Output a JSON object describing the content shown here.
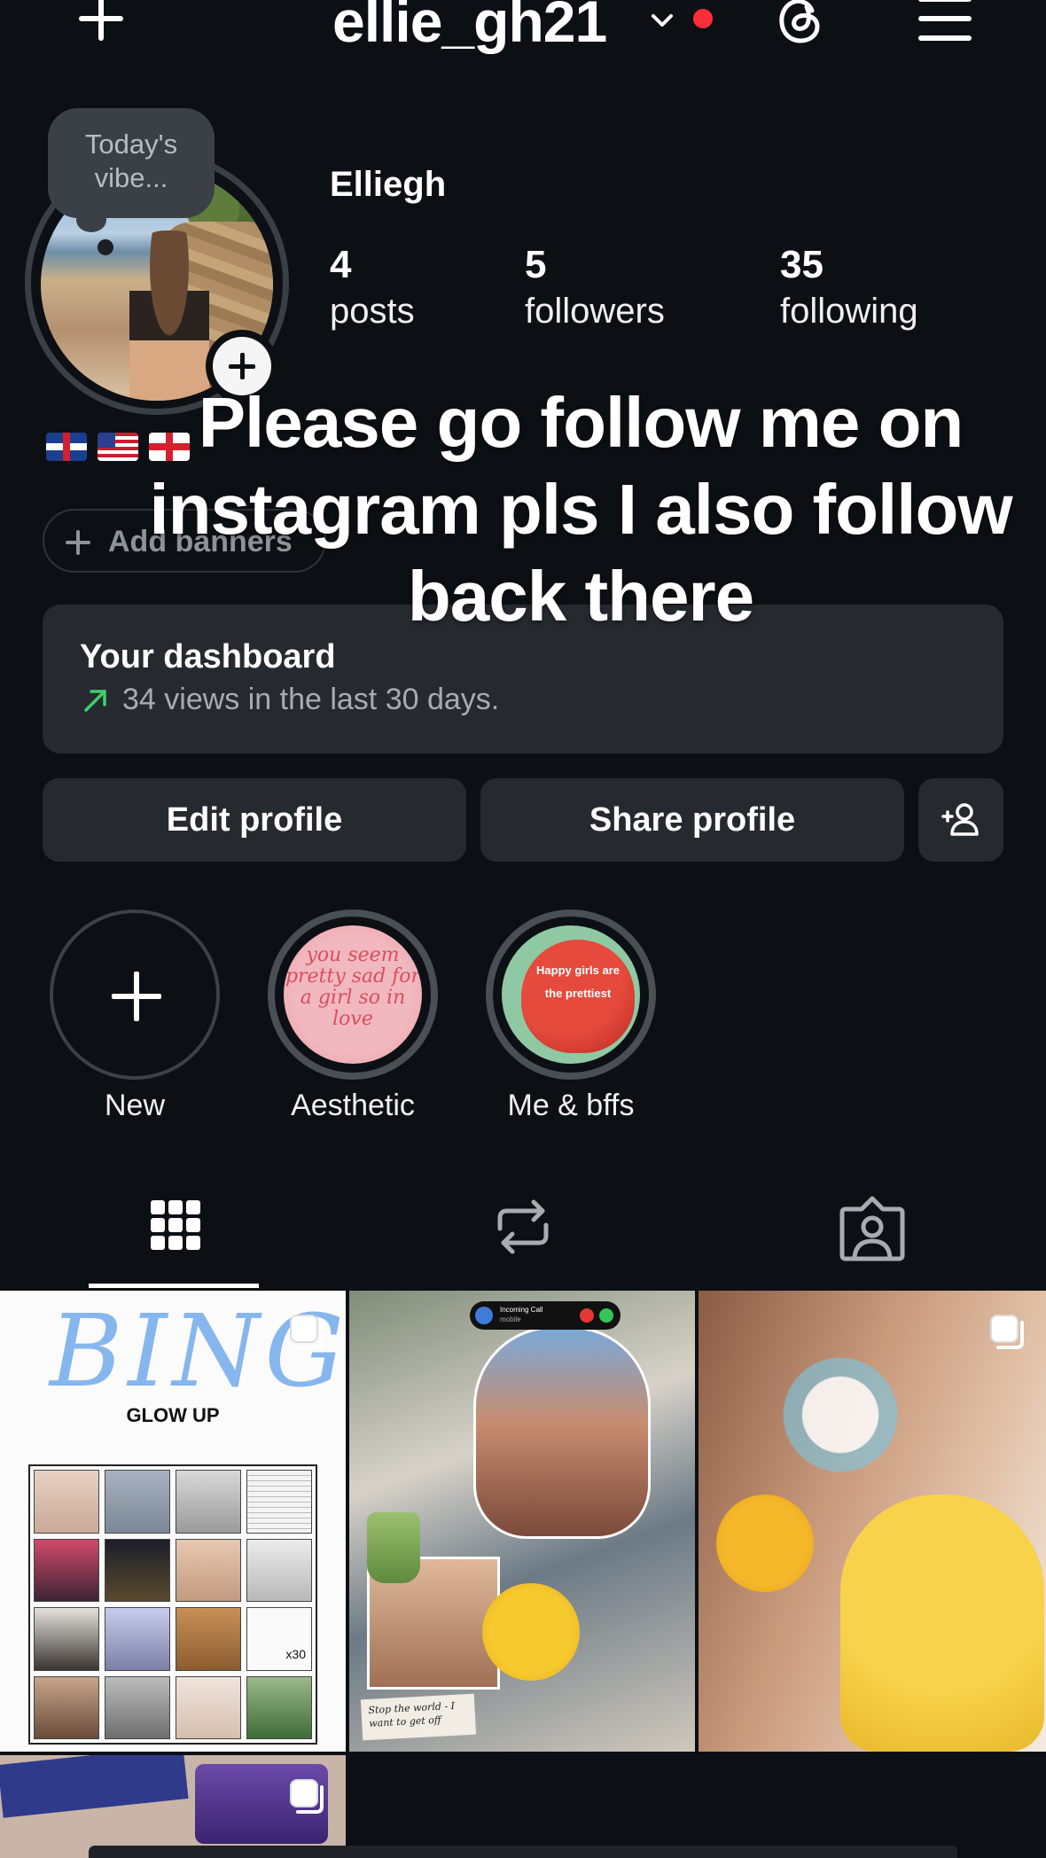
{
  "top_bar": {
    "username": "ellie_gh21",
    "icons": [
      "plus-icon",
      "chevron-down-icon",
      "notification-dot",
      "threads-icon",
      "menu-icon"
    ],
    "notification_color": "#ff2d3a"
  },
  "profile": {
    "note": "Today's vibe...",
    "display_name": "Elliegh",
    "stats": [
      {
        "value": "4",
        "label": "posts"
      },
      {
        "value": "5",
        "label": "followers"
      },
      {
        "value": "35",
        "label": "following"
      }
    ],
    "flags": [
      "uk-flag",
      "us-flag",
      "england-flag"
    ],
    "add_banners_label": "Add banners"
  },
  "overlay_caption": "Please go follow me on instagram pls I also follow back there",
  "dashboard": {
    "title": "Your dashboard",
    "subtitle": "34 views in the last 30 days.",
    "trend_color": "#3ecf6b"
  },
  "actions": {
    "edit_label": "Edit profile",
    "share_label": "Share profile"
  },
  "highlights": [
    {
      "label": "New"
    },
    {
      "label": "Aesthetic",
      "art_text": "you seem pretty sad for a girl so in love"
    },
    {
      "label": "Me & bffs",
      "art_text": "Happy girls are the prettiest"
    }
  ],
  "tabs": [
    "grid-icon",
    "reposts-icon",
    "tagged-icon"
  ],
  "posts": [
    {
      "title": "BINGO",
      "subtitle": "GLOW UP",
      "badge": "x30"
    },
    {
      "call_title": "Incoming Call",
      "call_sub": "mobile",
      "note_text": "Stop the world - I want to get off"
    },
    {},
    {}
  ],
  "colors": {
    "background": "#0c1014",
    "surface": "#262a30",
    "text": "#f5f5f5",
    "muted": "#a8acb2"
  }
}
